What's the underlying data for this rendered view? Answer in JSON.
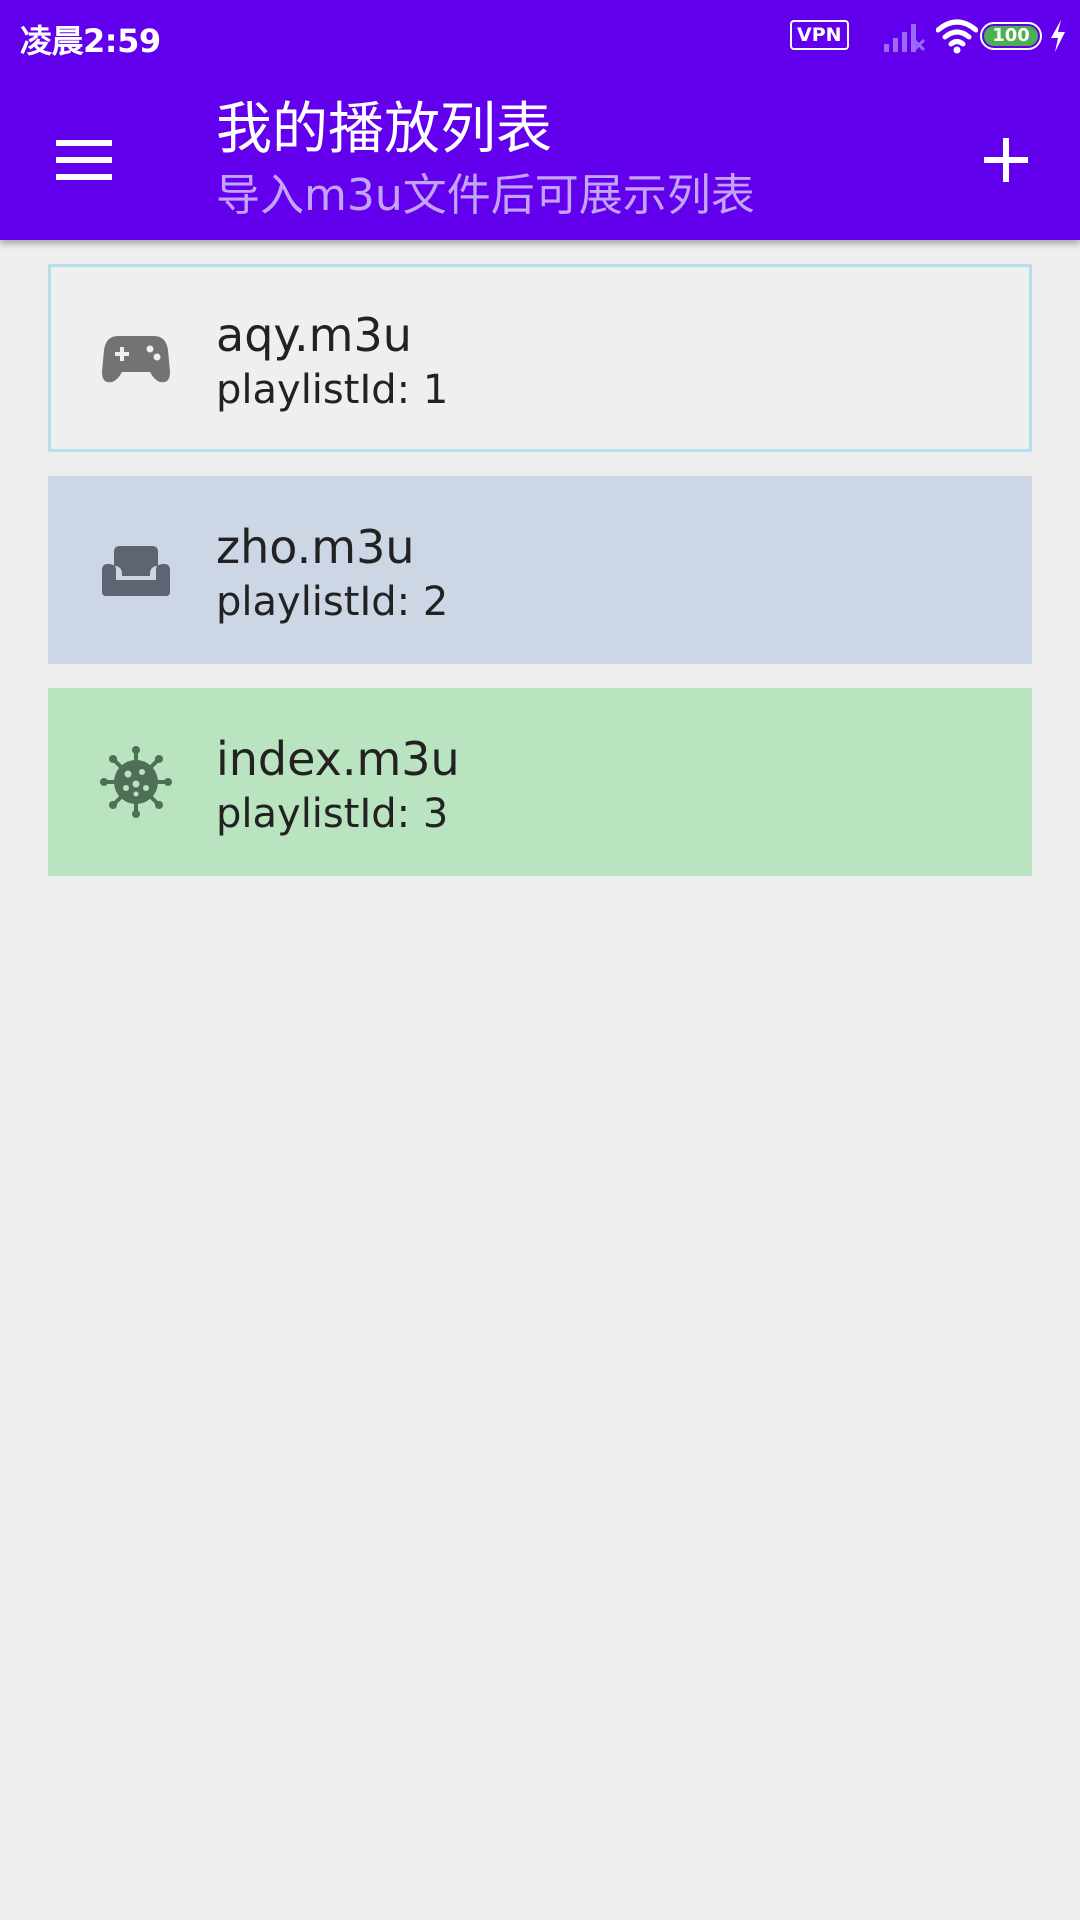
{
  "status_bar": {
    "time": "凌晨2:59",
    "vpn_label": "VPN",
    "battery_level": "100",
    "icons": [
      "vpn-icon",
      "signal-icon",
      "wifi-icon",
      "battery-icon",
      "charging-icon"
    ]
  },
  "toolbar": {
    "title": "我的播放列表",
    "subtitle": "导入m3u文件后可展示列表",
    "menu_icon": "menu-icon",
    "add_icon": "plus-icon"
  },
  "playlists": [
    {
      "name": "aqy.m3u",
      "sub": "playlistId: 1",
      "icon": "gamepad-icon",
      "bg_color": "#efefef",
      "border_color": "#b2dfeb"
    },
    {
      "name": "zho.m3u",
      "sub": "playlistId: 2",
      "icon": "sofa-icon",
      "bg_color": "#cdd6e5"
    },
    {
      "name": "index.m3u",
      "sub": "playlistId: 3",
      "icon": "virus-icon",
      "bg_color": "#bae3bf"
    }
  ],
  "colors": {
    "primary": "#6200ee",
    "subtitle": "#c4a3fb",
    "background": "#eeeeee",
    "icon_gray": "#737373",
    "icon_slate": "#5d6572",
    "icon_green": "#4f6f56"
  }
}
